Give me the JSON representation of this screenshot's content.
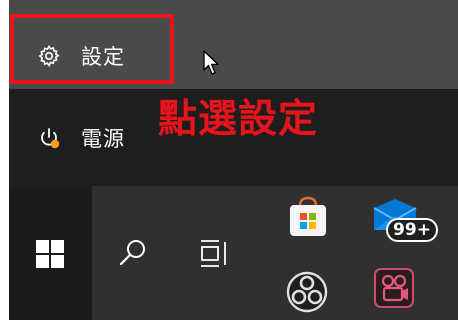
{
  "start_menu": {
    "settings_label": "設定",
    "power_label": "電源"
  },
  "annotation": {
    "text": "點選設定",
    "color": "#e8141b"
  },
  "taskbar": {
    "mail_badge": "99+"
  },
  "icons": [
    "gear-icon",
    "power-icon",
    "windows-logo-icon",
    "search-icon",
    "task-view-icon",
    "microsoft-store-icon",
    "mail-icon",
    "obs-studio-icon",
    "video-app-icon",
    "mouse-cursor"
  ]
}
